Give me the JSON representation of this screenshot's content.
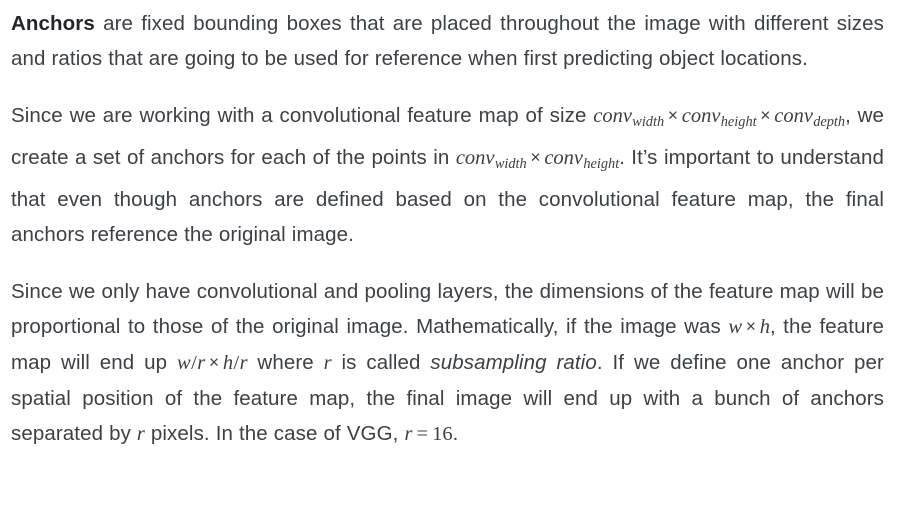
{
  "document": {
    "type": "article-text-excerpt",
    "background_color": "#ffffff",
    "text_color": "#3c4146",
    "strong_color": "#22262a",
    "paragraphs": [
      {
        "id": "p1",
        "lead_bold": "Anchors",
        "text_after_bold": " are fixed bounding boxes that are placed throughout the image with different sizes and ratios that are going to be used for reference when first predicting object locations."
      },
      {
        "id": "p2",
        "segment_1": "Since we are working with a convolutional feature map of size ",
        "math_1": {
          "base_1": "conv",
          "sub_1": "width",
          "op_1": "×",
          "base_2": "conv",
          "sub_2": "height",
          "op_2": "×",
          "base_3": "conv",
          "sub_3": "depth",
          "trailing": ","
        },
        "segment_2": " we create a set of anchors for each of the points in ",
        "math_2": {
          "base_1": "conv",
          "sub_1": "width",
          "op_1": "×",
          "base_2": "conv",
          "sub_2": "height",
          "trailing": "."
        },
        "segment_3": " It’s important to understand that even though anchors are defined based on the convolutional feature map, the final anchors reference the original image."
      },
      {
        "id": "p3",
        "segment_1": "Since we only have convolutional and pooling layers, the dimensions of the feature map will be proportional to those of the original image. Mathematically, if the image was ",
        "math_1": {
          "var_1": "w",
          "op_1": "×",
          "var_2": "h",
          "trailing": ","
        },
        "segment_2": " the feature map will end up ",
        "math_2": {
          "var_1": "w",
          "slash_1": "/",
          "var_2": "r",
          "op_1": "×",
          "var_3": "h",
          "slash_2": "/",
          "var_4": "r"
        },
        "segment_3": " where ",
        "math_3": {
          "var_1": "r"
        },
        "segment_4": " is called ",
        "italic_term": "subsampling ratio",
        "segment_5": ". If we define one anchor per spatial position of the feature map, the final image will end up with a bunch of anchors separated by ",
        "math_4": {
          "var_1": "r"
        },
        "segment_6": " pixels. In the case of VGG, ",
        "math_5": {
          "var_1": "r",
          "relation": "=",
          "value": "16"
        },
        "segment_7": "."
      }
    ]
  }
}
